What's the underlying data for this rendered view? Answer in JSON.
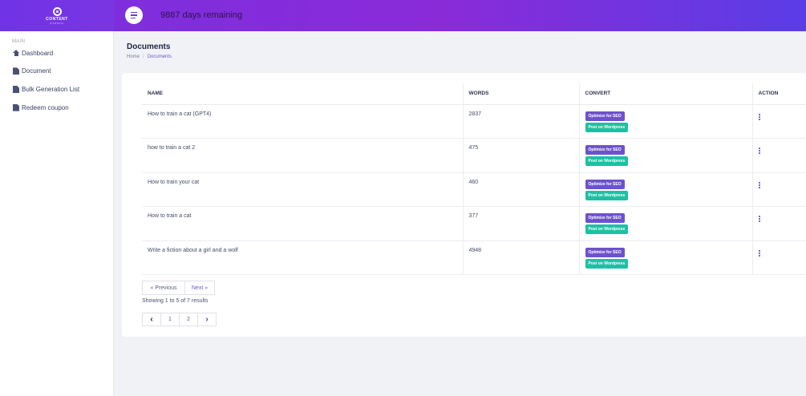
{
  "topbar": {
    "logo_text": "CONTENT",
    "logo_sub": "STUDIO",
    "days_remaining": "9887 days remaining"
  },
  "sidebar": {
    "heading": "MAIN",
    "items": [
      {
        "label": "Dashboard",
        "icon": "home-icon"
      },
      {
        "label": "Document",
        "icon": "document-icon"
      },
      {
        "label": "Bulk Generation List",
        "icon": "document-icon"
      },
      {
        "label": "Redeem coupon",
        "icon": "document-icon"
      }
    ]
  },
  "page": {
    "title": "Documents",
    "breadcrumb": [
      "Home",
      "Documents"
    ]
  },
  "table": {
    "headers": [
      "NAME",
      "WORDS",
      "CONVERT",
      "ACTION"
    ],
    "seo_label": "Optimize for SEO",
    "wp_label": "Post on Wordpress",
    "rows": [
      {
        "name": "How to train a cat (GPT4)",
        "words": "2837"
      },
      {
        "name": "how to train a cat 2",
        "words": "475"
      },
      {
        "name": "How to train your cat",
        "words": "460"
      },
      {
        "name": "How to train a cat",
        "words": "377"
      },
      {
        "name": "Write a fiction about a girl and a wolf",
        "words": "4948"
      }
    ]
  },
  "pagination": {
    "prev_label": "« Previous",
    "next_label": "Next »",
    "showing": "Showing 1 to 5 of 7 results",
    "pages": [
      "1",
      "2"
    ],
    "prev_arrow": "‹",
    "next_arrow": "›"
  },
  "colors": {
    "accent": "#7b2fe0",
    "seo": "#6e52cc",
    "wordpress": "#1ec0a3"
  }
}
